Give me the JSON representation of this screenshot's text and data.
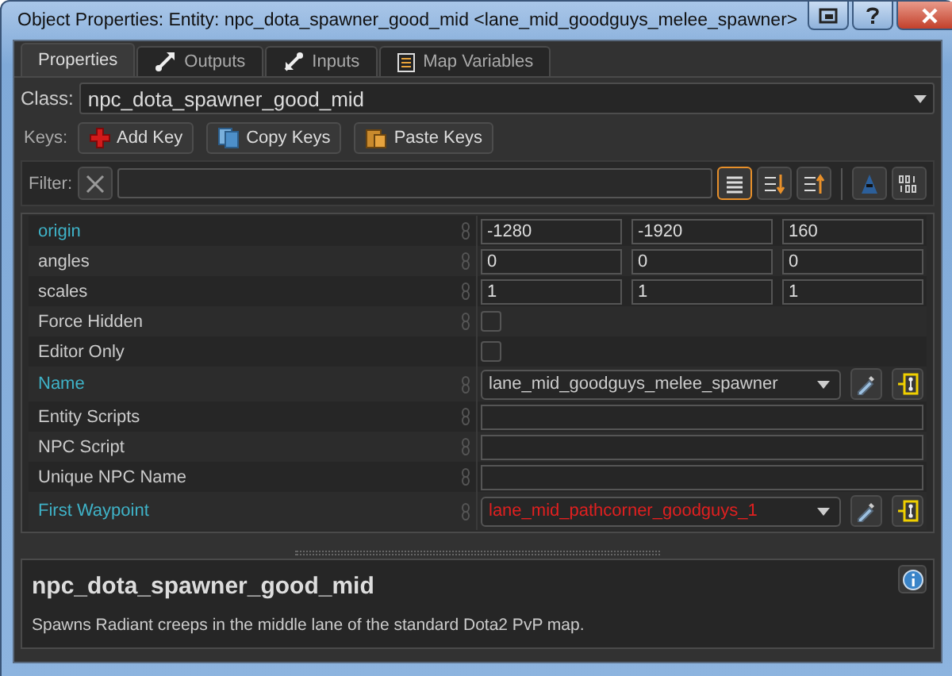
{
  "window": {
    "title": "Object Properties: Entity: npc_dota_spawner_good_mid  <lane_mid_goodguys_melee_spawner>"
  },
  "tabs": [
    {
      "label": "Properties",
      "kind": "none",
      "selected": true
    },
    {
      "label": "Outputs",
      "kind": "outputs",
      "selected": false
    },
    {
      "label": "Inputs",
      "kind": "inputs",
      "selected": false
    },
    {
      "label": "Map Variables",
      "kind": "variables",
      "selected": false
    }
  ],
  "class": {
    "label": "Class:",
    "value": "npc_dota_spawner_good_mid"
  },
  "keys": {
    "label": "Keys:",
    "buttons": [
      {
        "label": "Add Key",
        "kind": "add"
      },
      {
        "label": "Copy Keys",
        "kind": "copy"
      },
      {
        "label": "Paste Keys",
        "kind": "paste"
      }
    ]
  },
  "filter": {
    "label": "Filter:",
    "view_buttons": [
      {
        "kind": "list",
        "selected": true
      },
      {
        "kind": "sort-down",
        "selected": false
      },
      {
        "kind": "sort-up",
        "selected": false
      }
    ]
  },
  "properties": [
    {
      "name": "origin",
      "kind": "vector",
      "highlighted": true,
      "linked": true,
      "values": [
        "-1280",
        "-1920",
        "160"
      ]
    },
    {
      "name": "angles",
      "kind": "vector",
      "highlighted": false,
      "linked": true,
      "values": [
        "0",
        "0",
        "0"
      ]
    },
    {
      "name": "scales",
      "kind": "vector",
      "highlighted": false,
      "linked": true,
      "values": [
        "1",
        "1",
        "1"
      ]
    },
    {
      "name": "Force Hidden",
      "kind": "checkbox",
      "highlighted": false,
      "linked": true,
      "checked": false
    },
    {
      "name": "Editor Only",
      "kind": "checkbox",
      "highlighted": false,
      "linked": false,
      "checked": false
    },
    {
      "name": "Name",
      "kind": "target",
      "highlighted": true,
      "linked": true,
      "value": "lane_mid_goodguys_melee_spawner",
      "invalid": false
    },
    {
      "name": "Entity Scripts",
      "kind": "text",
      "highlighted": false,
      "linked": true
    },
    {
      "name": "NPC Script",
      "kind": "text",
      "highlighted": false,
      "linked": true
    },
    {
      "name": "Unique NPC Name",
      "kind": "text",
      "highlighted": false,
      "linked": true
    },
    {
      "name": "First Waypoint",
      "kind": "target",
      "highlighted": true,
      "linked": true,
      "value": "lane_mid_pathcorner_goodguys_1",
      "invalid": true
    }
  ],
  "description": {
    "title": "npc_dota_spawner_good_mid",
    "text": "Spawns Radiant creeps in the middle lane of the standard Dota2 PvP map."
  }
}
